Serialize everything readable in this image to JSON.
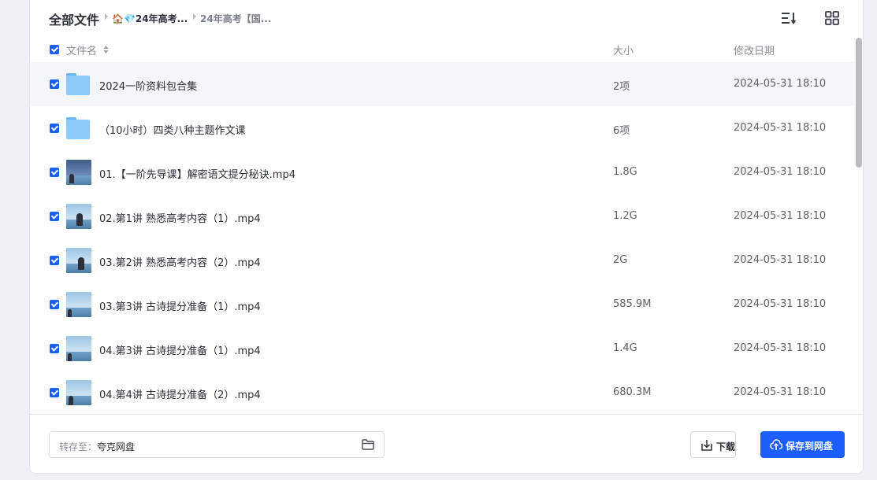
{
  "breadcrumb": {
    "root": "全部文件",
    "item1": "🏠💎24年高考...",
    "item2": "24年高考【国..."
  },
  "columns": {
    "name": "文件名",
    "size": "大小",
    "date": "修改日期"
  },
  "files": [
    {
      "type": "folder",
      "name": "2024一阶资料包合集",
      "size": "2项",
      "date": "2024-05-31 18:10"
    },
    {
      "type": "folder",
      "name": "（10小时）四类八种主题作文课",
      "size": "6项",
      "date": "2024-05-31 18:10"
    },
    {
      "type": "video",
      "name": "01.【一阶先导课】解密语文提分秘诀.mp4",
      "size": "1.8G",
      "date": "2024-05-31 18:10"
    },
    {
      "type": "video",
      "name": "02.第1讲 熟悉高考内容（1）.mp4",
      "size": "1.2G",
      "date": "2024-05-31 18:10"
    },
    {
      "type": "video",
      "name": "03.第2讲 熟悉高考内容（2）.mp4",
      "size": "2G",
      "date": "2024-05-31 18:10"
    },
    {
      "type": "video",
      "name": "03.第3讲 古诗提分准备（1）.mp4",
      "size": "585.9M",
      "date": "2024-05-31 18:10"
    },
    {
      "type": "video",
      "name": "04.第3讲 古诗提分准备（1）.mp4",
      "size": "1.4G",
      "date": "2024-05-31 18:10"
    },
    {
      "type": "video",
      "name": "04.第4讲 古诗提分准备（2）.mp4",
      "size": "680.3M",
      "date": "2024-05-31 18:10"
    }
  ],
  "footer": {
    "dest_label": "转存至：",
    "dest_value": "夸克网盘",
    "download_label": "下载",
    "save_label": "保存到网盘"
  },
  "icons": {
    "sort": "sort-icon",
    "grid": "grid-view-icon",
    "folder": "folder-icon",
    "download": "download-icon",
    "upload": "cloud-upload-icon"
  },
  "colors": {
    "accent": "#1b5efc",
    "folder": "#8ccaf7"
  }
}
